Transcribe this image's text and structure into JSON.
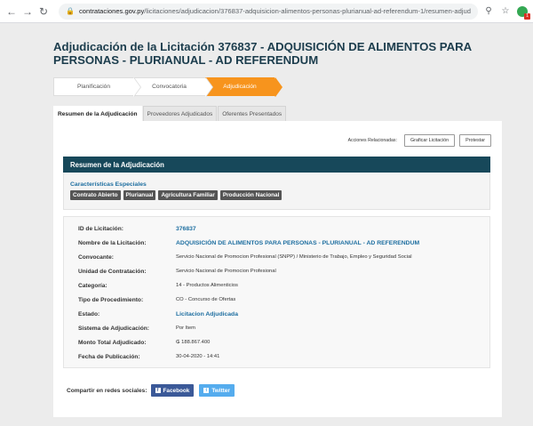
{
  "browser": {
    "url_domain": "contrataciones.gov.py",
    "url_path": "/licitaciones/adjudicacion/376837-adquisicion-alimentos-personas-plurianual-ad-referendum-1/resumen-adjudicacion.html",
    "ext_badge": "1"
  },
  "page": {
    "title": "Adjudicación de la Licitación 376837 - ADQUISICIÓN DE ALIMENTOS PARA PERSONAS - PLURIANUAL - AD REFERENDUM"
  },
  "steps": [
    {
      "label": "Planificación"
    },
    {
      "label": "Convocatoria"
    },
    {
      "label": "Adjudicación"
    }
  ],
  "tabs": [
    {
      "label": "Resumen de la Adjudicación"
    },
    {
      "label": "Proveedores Adjudicados"
    },
    {
      "label": "Oferentes Presentados"
    }
  ],
  "actions": {
    "label": "Acciones Relacionadas:",
    "graficar": "Graficar Licitación",
    "protestar": "Protestar"
  },
  "section": {
    "title": "Resumen de la Adjudicación"
  },
  "characteristics": {
    "title": "Características Especiales",
    "chips": [
      "Contrato Abierto",
      "Plurianual",
      "Agricultura Familiar",
      "Producción Nacional"
    ]
  },
  "details": [
    {
      "key": "ID de Licitación:",
      "value": "376837",
      "style": "link"
    },
    {
      "key": "Nombre de la Licitación:",
      "value": "ADQUISICIÓN DE ALIMENTOS PARA PERSONAS - PLURIANUAL - AD REFERENDUM",
      "style": "link"
    },
    {
      "key": "Convocante:",
      "value": "Servicio Nacional de Promocion Profesional (SNPP) / Ministerio de Trabajo, Empleo y Seguridad Social",
      "style": "plain"
    },
    {
      "key": "Unidad de Contratación:",
      "value": "Servicio Nacional de Promocion Profesional",
      "style": "plain"
    },
    {
      "key": "Categoría:",
      "value": "14 - Productos Alimenticios",
      "style": "plain"
    },
    {
      "key": "Tipo de Procedimiento:",
      "value": "CO - Concurso de Ofertas",
      "style": "plain"
    },
    {
      "key": "Estado:",
      "value": "Licitacion Adjudicada",
      "style": "link"
    },
    {
      "key": "Sistema de Adjudicación:",
      "value": "Por Item",
      "style": "plain"
    },
    {
      "key": "Monto Total Adjudicado:",
      "value": "₲ 188.867.400",
      "style": "plain"
    },
    {
      "key": "Fecha de Publicación:",
      "value": "30-04-2020 - 14:41",
      "style": "plain"
    }
  ],
  "share": {
    "label": "Compartir en redes sociales:",
    "facebook": "Facebook",
    "twitter": "Twitter"
  },
  "colors": {
    "accent_orange": "#f7941d",
    "header_dark": "#17485a",
    "link_blue": "#1d6ea0",
    "title_dark": "#1c3d4d"
  }
}
